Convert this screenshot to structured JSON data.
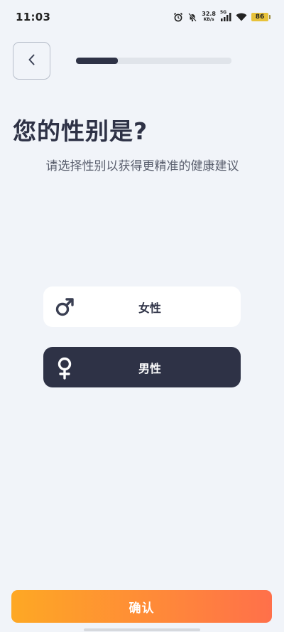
{
  "status_bar": {
    "time": "11:03",
    "net_speed_value": "32.8",
    "net_speed_unit": "KB/s",
    "network_type": "5G",
    "battery_level": "86",
    "icons": [
      "alarm-icon",
      "mute-icon",
      "signal-icon",
      "wifi-icon",
      "battery-icon"
    ]
  },
  "header": {
    "back_icon": "chevron-left-icon",
    "progress_fraction": 0.27
  },
  "main": {
    "title": "您的性别是?",
    "subtitle": "请选择性别以获得更精准的健康建议",
    "options": [
      {
        "label": "女性",
        "icon": "male-symbol-icon",
        "selected": false
      },
      {
        "label": "男性",
        "icon": "female-symbol-icon",
        "selected": true
      }
    ]
  },
  "footer": {
    "confirm_label": "确认"
  },
  "colors": {
    "background": "#f1f4f9",
    "primary_dark": "#2e3246",
    "accent_start": "#fea824",
    "accent_end": "#ff704a"
  }
}
